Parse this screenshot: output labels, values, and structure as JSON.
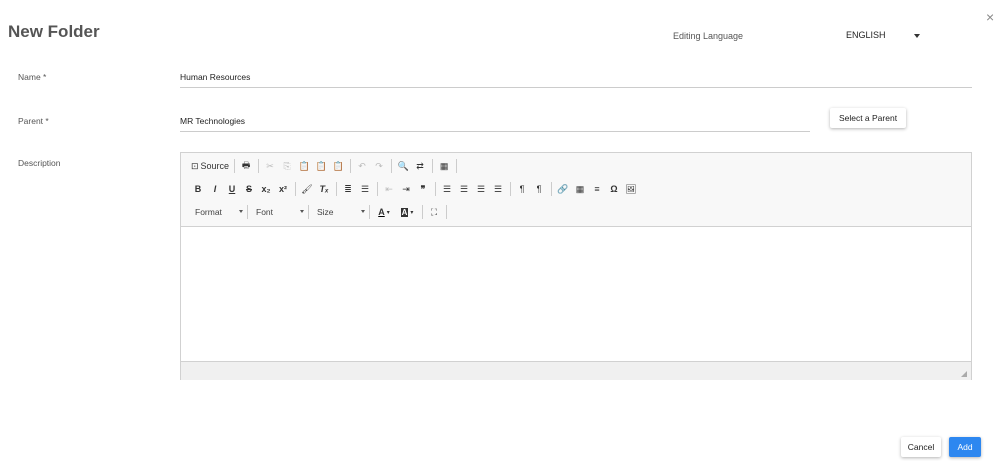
{
  "dialog": {
    "title": "New Folder",
    "close_glyph": "×"
  },
  "language": {
    "label": "Editing Language",
    "value": "ENGLISH"
  },
  "form": {
    "name_label": "Name *",
    "name_value": "Human Resources",
    "parent_label": "Parent *",
    "parent_value": "MR Technologies",
    "select_parent_label": "Select a Parent",
    "description_label": "Description"
  },
  "editor": {
    "row1": [
      {
        "name": "source-button",
        "icon": "source-icon",
        "glyph": "⊡",
        "label": "Source"
      },
      {
        "sep": true
      },
      {
        "name": "print-button",
        "icon": "print-icon",
        "glyph": "🖶"
      },
      {
        "sep": true
      },
      {
        "name": "cut-button",
        "icon": "cut-icon",
        "glyph": "✂",
        "disabled": true
      },
      {
        "name": "copy-button",
        "icon": "copy-icon",
        "glyph": "⎘",
        "disabled": true
      },
      {
        "name": "paste-button",
        "icon": "paste-icon",
        "glyph": "📋"
      },
      {
        "name": "paste-text-button",
        "icon": "paste-text-icon",
        "glyph": "📋"
      },
      {
        "name": "paste-word-button",
        "icon": "paste-word-icon",
        "glyph": "📋"
      },
      {
        "sep": true
      },
      {
        "name": "undo-button",
        "icon": "undo-icon",
        "glyph": "↶",
        "disabled": true
      },
      {
        "name": "redo-button",
        "icon": "redo-icon",
        "glyph": "↷",
        "disabled": true
      },
      {
        "sep": true
      },
      {
        "name": "find-button",
        "icon": "search-icon",
        "glyph": "🔍"
      },
      {
        "name": "replace-button",
        "icon": "replace-icon",
        "glyph": "⇄"
      },
      {
        "sep": true
      },
      {
        "name": "select-all-button",
        "icon": "select-all-icon",
        "glyph": "▦"
      },
      {
        "sep": true
      }
    ],
    "row2": [
      {
        "name": "bold-button",
        "icon": "bold-icon",
        "glyph": "B",
        "style": "font-weight:bold"
      },
      {
        "name": "italic-button",
        "icon": "italic-icon",
        "glyph": "I",
        "style": "font-style:italic;font-weight:bold"
      },
      {
        "name": "underline-button",
        "icon": "underline-icon",
        "glyph": "U",
        "style": "text-decoration:underline;font-weight:bold"
      },
      {
        "name": "strike-button",
        "icon": "strikethrough-icon",
        "glyph": "S",
        "style": "text-decoration:line-through;font-weight:bold"
      },
      {
        "name": "subscript-button",
        "icon": "subscript-icon",
        "glyph": "x₂",
        "style": "font-weight:bold"
      },
      {
        "name": "superscript-button",
        "icon": "superscript-icon",
        "glyph": "x²",
        "style": "font-weight:bold"
      },
      {
        "sep": true
      },
      {
        "name": "copy-format-button",
        "icon": "brush-icon",
        "glyph": "🖌"
      },
      {
        "name": "remove-format-button",
        "icon": "remove-format-icon",
        "glyph": "Tₓ",
        "style": "font-style:italic;font-weight:bold"
      },
      {
        "sep": true
      },
      {
        "name": "numbered-list-button",
        "icon": "numbered-list-icon",
        "glyph": "≣"
      },
      {
        "name": "bulleted-list-button",
        "icon": "bulleted-list-icon",
        "glyph": "☰"
      },
      {
        "sep": true
      },
      {
        "name": "outdent-button",
        "icon": "outdent-icon",
        "glyph": "⇤",
        "disabled": true
      },
      {
        "name": "indent-button",
        "icon": "indent-icon",
        "glyph": "⇥"
      },
      {
        "name": "blockquote-button",
        "icon": "blockquote-icon",
        "glyph": "❞",
        "style": "font-weight:bold"
      },
      {
        "sep": true
      },
      {
        "name": "align-left-button",
        "icon": "align-left-icon",
        "glyph": "☰"
      },
      {
        "name": "align-center-button",
        "icon": "align-center-icon",
        "glyph": "☰"
      },
      {
        "name": "align-right-button",
        "icon": "align-right-icon",
        "glyph": "☰"
      },
      {
        "name": "align-justify-button",
        "icon": "align-justify-icon",
        "glyph": "☰"
      },
      {
        "sep": true
      },
      {
        "name": "ltr-button",
        "icon": "text-direction-ltr-icon",
        "glyph": "¶"
      },
      {
        "name": "rtl-button",
        "icon": "text-direction-rtl-icon",
        "glyph": "¶"
      },
      {
        "sep": true
      },
      {
        "name": "link-button",
        "icon": "link-icon",
        "glyph": "🔗"
      },
      {
        "name": "table-button",
        "icon": "table-icon",
        "glyph": "▦"
      },
      {
        "name": "hr-button",
        "icon": "horizontal-line-icon",
        "glyph": "≡"
      },
      {
        "name": "special-char-button",
        "icon": "omega-icon",
        "glyph": "Ω",
        "style": "font-weight:bold"
      },
      {
        "name": "image-button",
        "icon": "image-icon",
        "glyph": "🖼"
      }
    ],
    "row3": {
      "format_label": "Format",
      "font_label": "Font",
      "size_label": "Size",
      "text_color_glyph": "A",
      "bg_color_glyph": "A",
      "maximize_glyph": "⛶"
    }
  },
  "footer": {
    "cancel_label": "Cancel",
    "add_label": "Add"
  },
  "colors": {
    "primary": "#2d87f0"
  }
}
